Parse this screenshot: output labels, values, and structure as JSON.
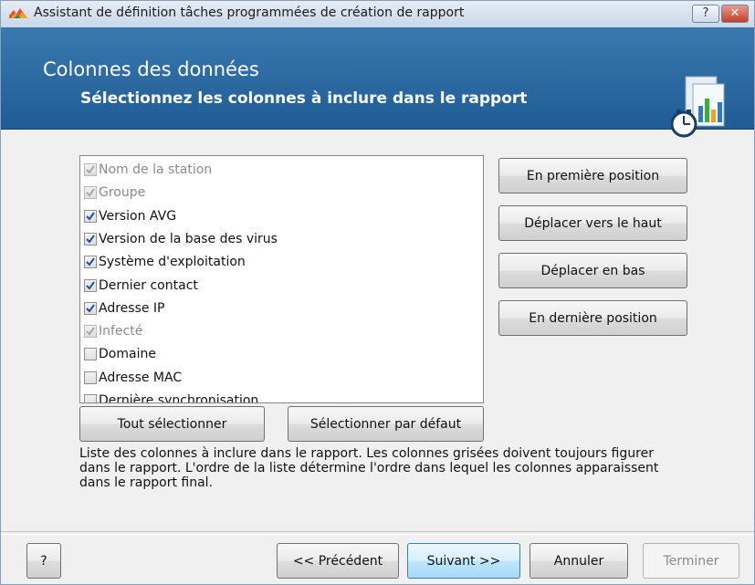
{
  "window": {
    "title": "Assistant de définition tâches programmées de création de rapport",
    "help_button": "?",
    "close_button": "✕"
  },
  "header": {
    "title": "Colonnes des données",
    "subtitle": "Sélectionnez les colonnes à inclure dans le rapport"
  },
  "columns_list": {
    "items": [
      {
        "label": "Nom de la station",
        "checked": true,
        "disabled": true
      },
      {
        "label": "Groupe",
        "checked": true,
        "disabled": true
      },
      {
        "label": "Version AVG",
        "checked": true,
        "disabled": false
      },
      {
        "label": "Version de la base des virus",
        "checked": true,
        "disabled": false
      },
      {
        "label": "Système d'exploitation",
        "checked": true,
        "disabled": false
      },
      {
        "label": "Dernier contact",
        "checked": true,
        "disabled": false
      },
      {
        "label": "Adresse IP",
        "checked": true,
        "disabled": false
      },
      {
        "label": "Infecté",
        "checked": true,
        "disabled": true
      },
      {
        "label": "Domaine",
        "checked": false,
        "disabled": false
      },
      {
        "label": "Adresse MAC",
        "checked": false,
        "disabled": false
      },
      {
        "label": "Dernière synchronisation",
        "checked": false,
        "disabled": false
      }
    ]
  },
  "order_buttons": {
    "first": "En première position",
    "up": "Déplacer vers le haut",
    "down": "Déplacer en bas",
    "last": "En dernière position"
  },
  "list_buttons": {
    "select_all": "Tout sélectionner",
    "select_default": "Sélectionner par défaut"
  },
  "description": {
    "line1": "Liste des colonnes à inclure dans le rapport. Les colonnes grisées doivent toujours figurer",
    "line2": "dans le rapport. L'ordre de la liste détermine l'ordre dans lequel les colonnes apparaissent",
    "line3": "dans le rapport final."
  },
  "footer": {
    "help": "?",
    "previous": "<< Précédent",
    "next": "Suivant >>",
    "cancel": "Annuler",
    "finish": "Terminer"
  },
  "icons": {
    "app": "avg-logo-icon",
    "banner": "report-schedule-icon",
    "checkmark": "checkmark-icon"
  },
  "colors": {
    "banner": "#2b6aa3",
    "check_enabled": "#1f4fa8",
    "check_disabled": "#a8a8a8"
  }
}
